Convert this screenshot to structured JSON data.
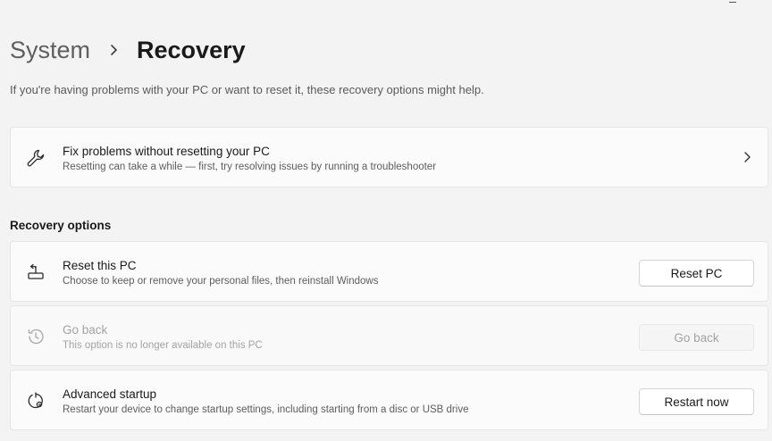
{
  "breadcrumb": {
    "parent": "System",
    "current": "Recovery"
  },
  "intro": "If you're having problems with your PC or want to reset it, these recovery options might help.",
  "fix_card": {
    "title": "Fix problems without resetting your PC",
    "description": "Resetting can take a while — first, try resolving issues by running a troubleshooter",
    "icon": "wrench-icon"
  },
  "section_label": "Recovery options",
  "options": {
    "reset": {
      "title": "Reset this PC",
      "description": "Choose to keep or remove your personal files, then reinstall Windows",
      "button": "Reset PC",
      "icon": "reset-pc-icon"
    },
    "go_back": {
      "title": "Go back",
      "description": "This option is no longer available on this PC",
      "button": "Go back",
      "icon": "history-icon",
      "disabled": true
    },
    "advanced": {
      "title": "Advanced startup",
      "description": "Restart your device to change startup settings, including starting from a disc or USB drive",
      "button": "Restart now",
      "icon": "advanced-startup-icon"
    }
  },
  "colors": {
    "background": "#f3f3f3",
    "card": "#fbfbfb",
    "disabled_text": "#a3a3a3"
  }
}
